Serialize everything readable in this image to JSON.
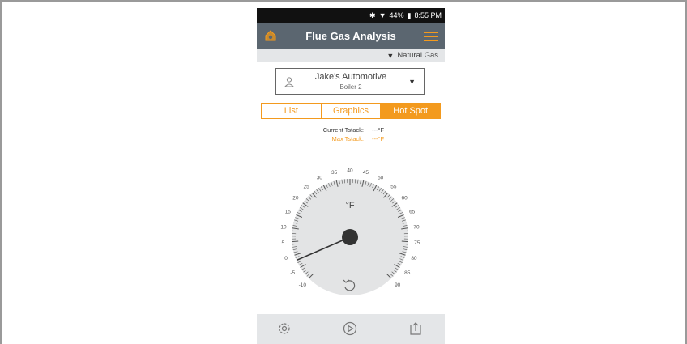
{
  "status": {
    "battery": "44%",
    "time": "8:55 PM",
    "bluetooth_icon": "bluetooth-icon",
    "wifi_icon": "wifi-icon",
    "battery_icon": "battery-icon"
  },
  "appbar": {
    "title": "Flue Gas Analysis",
    "home_icon": "home-icon",
    "menu_icon": "menu-icon"
  },
  "fuel": {
    "selected": "Natural Gas"
  },
  "customer": {
    "name": "Jake's Automotive",
    "location": "Boiler 2"
  },
  "tabs": [
    {
      "label": "List",
      "active": false
    },
    {
      "label": "Graphics",
      "active": false
    },
    {
      "label": "Hot Spot",
      "active": true
    }
  ],
  "readings": {
    "current_label": "Current Tstack:",
    "current_value": "---°F",
    "max_label": "Max Tstack:",
    "max_value": "---°F"
  },
  "gauge": {
    "unit": "°F",
    "min": -10,
    "max": 90,
    "labels": [
      -10,
      -5,
      0,
      5,
      10,
      15,
      20,
      25,
      30,
      35,
      40,
      45,
      50,
      55,
      60,
      65,
      70,
      75,
      80,
      85,
      90
    ],
    "needle_value": -2,
    "reset_icon": "reset-icon"
  },
  "bottombar": {
    "settings_icon": "gear-icon",
    "play_icon": "play-icon",
    "export_icon": "export-icon"
  },
  "colors": {
    "accent": "#f39a1e",
    "appbar": "#5b6670",
    "dial": "#e3e4e5"
  }
}
